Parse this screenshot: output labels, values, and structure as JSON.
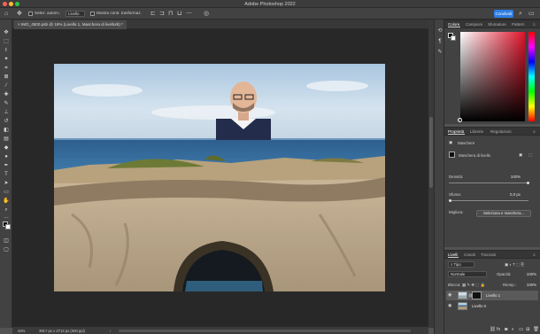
{
  "window": {
    "title": "Adobe Photoshop 2022",
    "traffic_lights": [
      "#ff5f57",
      "#febc2e",
      "#28c840"
    ]
  },
  "options_bar": {
    "home_icon": "home-icon",
    "move_icon": "move-tool-icon",
    "auto_select_label": "Selez. autom.:",
    "auto_select_value": "Livello",
    "show_transform_label": "Mostra contr. trasformaz.",
    "share_label": "Condividi",
    "accent": "#2d7ce4"
  },
  "document": {
    "tab_title": "IMG_4500.psb @ 18% (Livello 1, Maschera di livello/8) *",
    "zoom": "44%",
    "dimensions": "3917 px x 2713 px (300 ppi)"
  },
  "tools": [
    "move",
    "marquee",
    "lasso",
    "magic-wand",
    "crop",
    "frame",
    "eyedropper",
    "healing",
    "brush",
    "stamp",
    "history-brush",
    "eraser",
    "gradient",
    "blur",
    "dodge",
    "pen",
    "type",
    "path-select",
    "rectangle",
    "hand",
    "zoom",
    "more"
  ],
  "color_panel": {
    "tabs": [
      "Colore",
      "Campioni",
      "Sfumature",
      "Pattern"
    ],
    "active_tab": "Colore",
    "hue_color": "#e0142b"
  },
  "properties_panel": {
    "tabs": [
      "Proprietà",
      "Librerie",
      "Regolazioni"
    ],
    "active_tab": "Proprietà",
    "section": "Maschere",
    "mask_label": "Maschera di livello",
    "density_label": "Densità:",
    "density_value": "100%",
    "density_level": 1.0,
    "feather_label": "Sfuma:",
    "feather_value": "0,0 px",
    "feather_level": 0.0,
    "refine_label": "Migliora:",
    "select_mask_button": "Seleziona e maschera..."
  },
  "layers_panel": {
    "tabs": [
      "Livelli",
      "Canali",
      "Tracciati"
    ],
    "active_tab": "Livelli",
    "filter_label": "Tipo",
    "blend_mode": "Normale",
    "opacity_label": "Opacità:",
    "opacity_value": "100%",
    "lock_label": "Blocca:",
    "fill_label": "Riemp.:",
    "fill_value": "100%",
    "layers": [
      {
        "name": "Livello 1",
        "selected": true,
        "has_mask": true
      },
      {
        "name": "Livello 0",
        "selected": false,
        "has_mask": false
      }
    ]
  }
}
